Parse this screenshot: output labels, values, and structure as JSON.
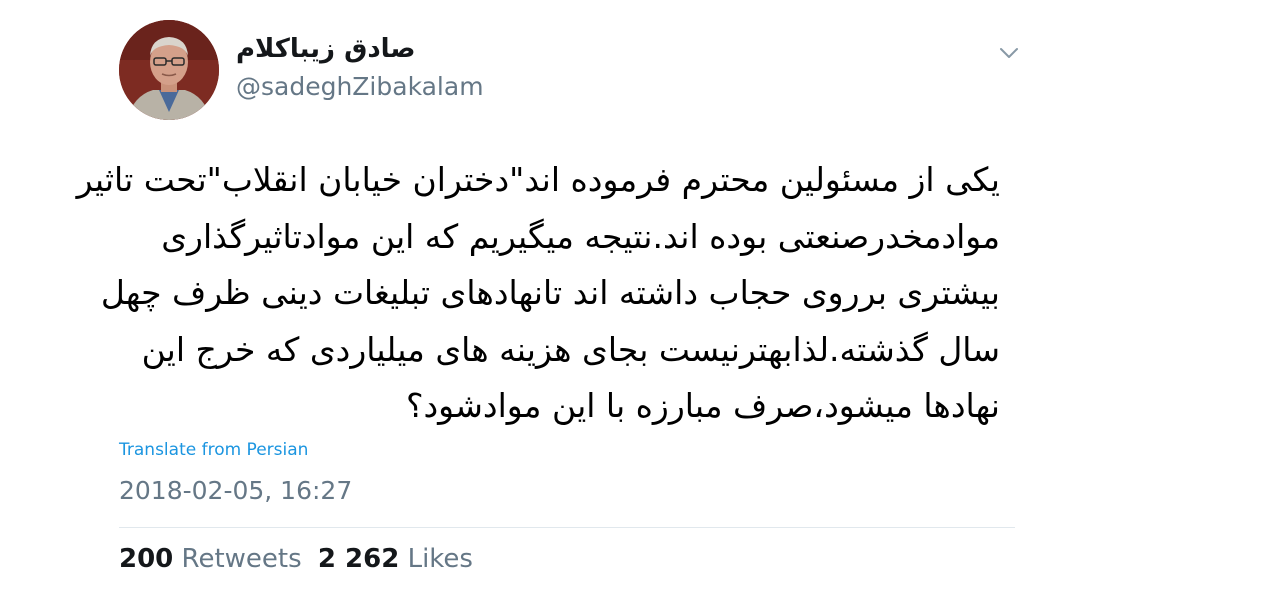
{
  "user": {
    "display_name": "صادق زیباکلام",
    "handle": "@sadeghZibakalam",
    "avatar_icon": "profile-photo"
  },
  "menu": {
    "icon": "chevron-down-icon"
  },
  "tweet": {
    "lines": [
      "یکی از مسئولین محترم فرموده اند\"دختران خیابان انقلاب\"تحت تاثیر",
      "موادمخدرصنعتی بوده اند.نتیجه میگیریم که این موادتاثیرگذاری",
      "بیشتری برروی حجاب داشته اند تانهادهای تبلیغات دینی ظرف چهل",
      "سال گذشته.لذابهترنیست بجای هزینه های میلیاردی که خرج این",
      "نهادها میشود،صرف مبارزه با این موادشود؟"
    ],
    "translate_label": "Translate from Persian",
    "timestamp": "2018-02-05, 16:27"
  },
  "stats": {
    "retweets_count": "200",
    "retweets_label": "Retweets",
    "likes_count": "2 262",
    "likes_label": "Likes"
  },
  "colors": {
    "secondary_text": "#657786",
    "link": "#1b95e0",
    "divider": "#e1e8ed"
  }
}
